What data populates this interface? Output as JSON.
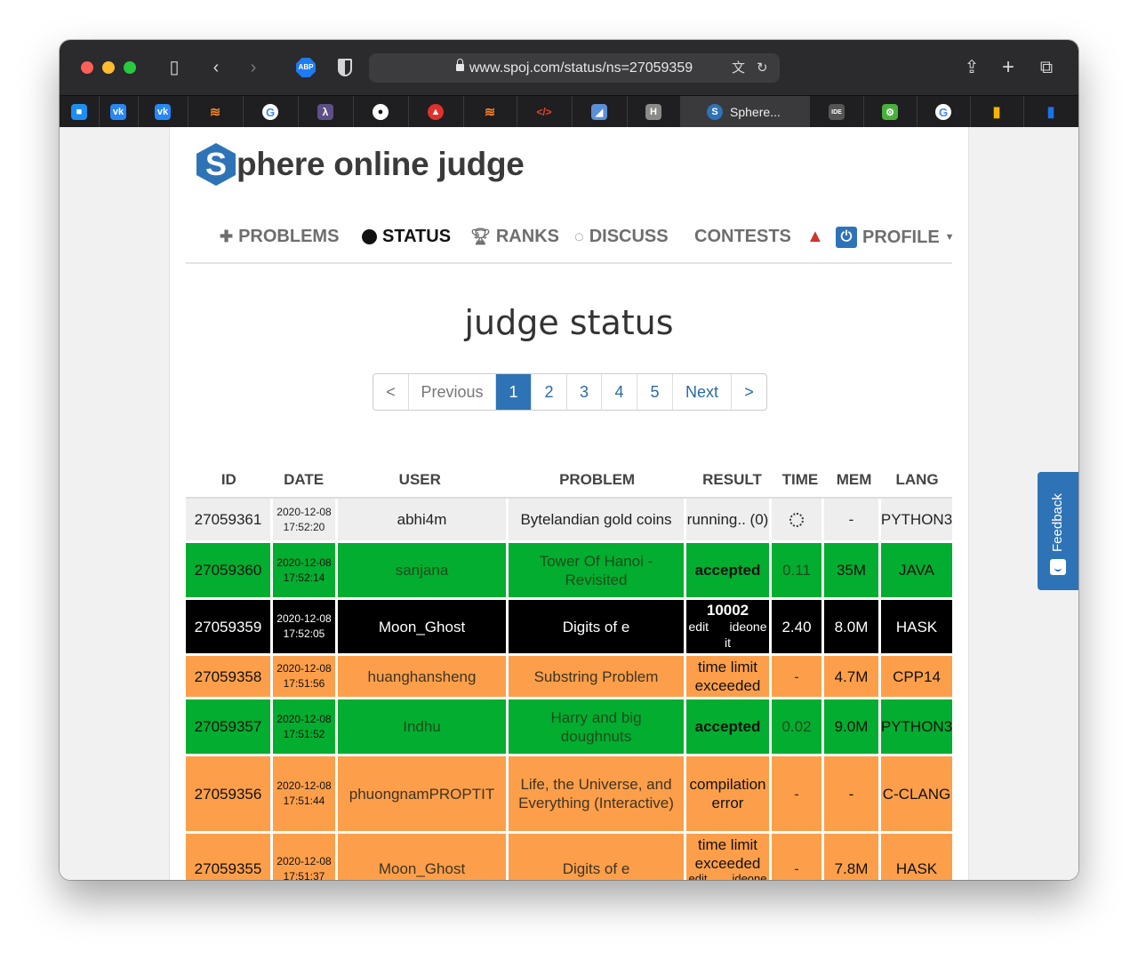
{
  "browser": {
    "url": "www.spoj.com/status/ns=27059359",
    "active_tab_title": "Sphere...",
    "tabs": [
      "chat",
      "vk",
      "vk",
      "stackoverflow",
      "google",
      "haskell",
      "github",
      "brave",
      "stackoverflow",
      "code",
      "app",
      "hoogle",
      "sphere",
      "ideone",
      "settings",
      "google",
      "charts",
      "charts"
    ]
  },
  "site": {
    "logo_letter": "S",
    "logo_text": "phere online judge",
    "nav": {
      "problems": "PROBLEMS",
      "status": "STATUS",
      "ranks": "RANKS",
      "discuss": "DISCUSS",
      "contests": "CONTESTS",
      "profile": "PROFILE"
    }
  },
  "page": {
    "title": "judge status",
    "pager": {
      "first": "<",
      "previous": "Previous",
      "pages": [
        "1",
        "2",
        "3",
        "4",
        "5"
      ],
      "current": "1",
      "next": "Next",
      "last": ">"
    }
  },
  "table": {
    "headers": {
      "id": "ID",
      "date": "DATE",
      "user": "USER",
      "problem": "PROBLEM",
      "result": "RESULT",
      "time": "TIME",
      "mem": "MEM",
      "lang": "LANG"
    },
    "rows": [
      {
        "id": "27059361",
        "date": "2020-12-08",
        "clock": "17:52:20",
        "user": "abhi4m",
        "problem": "Bytelandian gold coins",
        "result": "running.. (0)",
        "time": "",
        "mem": "-",
        "lang": "PYTHON3"
      },
      {
        "id": "27059360",
        "date": "2020-12-08",
        "clock": "17:52:14",
        "user": "sanjana",
        "problem": "Tower Of Hanoi - Revisited",
        "result": "accepted",
        "time": "0.11",
        "mem": "35M",
        "lang": "JAVA"
      },
      {
        "id": "27059359",
        "date": "2020-12-08",
        "clock": "17:52:05",
        "user": "Moon_Ghost",
        "problem": "Digits of e",
        "result": "10002",
        "result_link1": "edit",
        "result_link2": "ideone",
        "result_link3": "it",
        "time": "2.40",
        "mem": "8.0M",
        "lang": "HASK"
      },
      {
        "id": "27059358",
        "date": "2020-12-08",
        "clock": "17:51:56",
        "user": "huanghansheng",
        "problem": "Substring Problem",
        "result": "time limit exceeded",
        "time": "-",
        "mem": "4.7M",
        "lang": "CPP14"
      },
      {
        "id": "27059357",
        "date": "2020-12-08",
        "clock": "17:51:52",
        "user": "Indhu",
        "problem": "Harry and big doughnuts",
        "result": "accepted",
        "time": "0.02",
        "mem": "9.0M",
        "lang": "PYTHON3"
      },
      {
        "id": "27059356",
        "date": "2020-12-08",
        "clock": "17:51:44",
        "user": "phuongnamPROPTIT",
        "problem": "Life, the Universe, and Everything (Interactive)",
        "result": "compilation error",
        "time": "-",
        "mem": "-",
        "lang": "C-CLANG"
      },
      {
        "id": "27059355",
        "date": "2020-12-08",
        "clock": "17:51:37",
        "user": "Moon_Ghost",
        "problem": "Digits of e",
        "result": "time limit exceeded",
        "result_link1": "edit",
        "result_link2": "ideone",
        "time": "-",
        "mem": "7.8M",
        "lang": "HASK"
      }
    ]
  },
  "feedback": {
    "label": "Feedback"
  }
}
